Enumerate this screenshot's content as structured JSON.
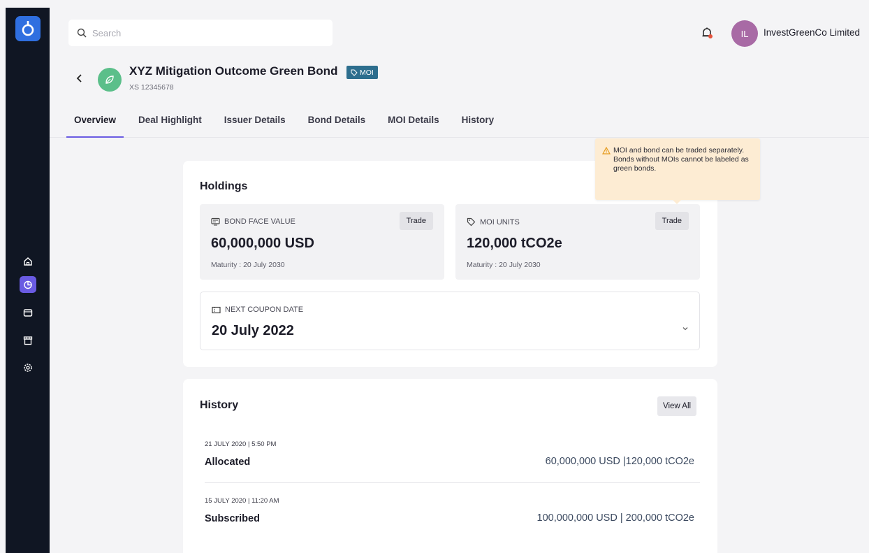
{
  "search": {
    "placeholder": "Search"
  },
  "user": {
    "initials": "IL",
    "name": "InvestGreenCo Limited"
  },
  "bond": {
    "title": "XYZ Mitigation Outcome Green Bond",
    "badge": "MOI",
    "code": "XS 12345678"
  },
  "tabs": [
    {
      "label": "Overview"
    },
    {
      "label": "Deal Highlight"
    },
    {
      "label": "Issuer Details"
    },
    {
      "label": "Bond Details"
    },
    {
      "label": "MOI Details"
    },
    {
      "label": "History"
    }
  ],
  "tooltip": {
    "line1": "MOI and bond can be traded separately.",
    "line2": "Bonds without MOIs cannot be labeled as green bonds."
  },
  "holdings": {
    "title": "Holdings",
    "bond_face": {
      "label": "BOND FACE VALUE",
      "value": "60,000,000 USD",
      "maturity": "Maturity : 20 July 2030",
      "trade": "Trade"
    },
    "moi_units": {
      "label": "MOI UNITS",
      "value": "120,000 tCO2e",
      "maturity": "Maturity : 20 July 2030",
      "trade": "Trade"
    },
    "coupon": {
      "label": "NEXT COUPON DATE",
      "value": "20 July 2022"
    }
  },
  "history": {
    "title": "History",
    "view_all": "View All",
    "rows": [
      {
        "date": "21 JULY 2020 | 5:50 PM",
        "status": "Allocated",
        "amount": "60,000,000 USD |120,000 tCO2e"
      },
      {
        "date": "15 JULY 2020 | 11:20 AM",
        "status": "Subscribed",
        "amount": "100,000,000 USD | 200,000 tCO2e"
      }
    ]
  },
  "colors": {
    "accent": "#6a5be2",
    "sidebar": "#101623",
    "bond_icon": "#5bbf8a",
    "badge": "#2d6e8e",
    "tooltip_bg": "#fdecd3",
    "avatar": "#a86aa5",
    "notification_dot": "#e5533d"
  }
}
